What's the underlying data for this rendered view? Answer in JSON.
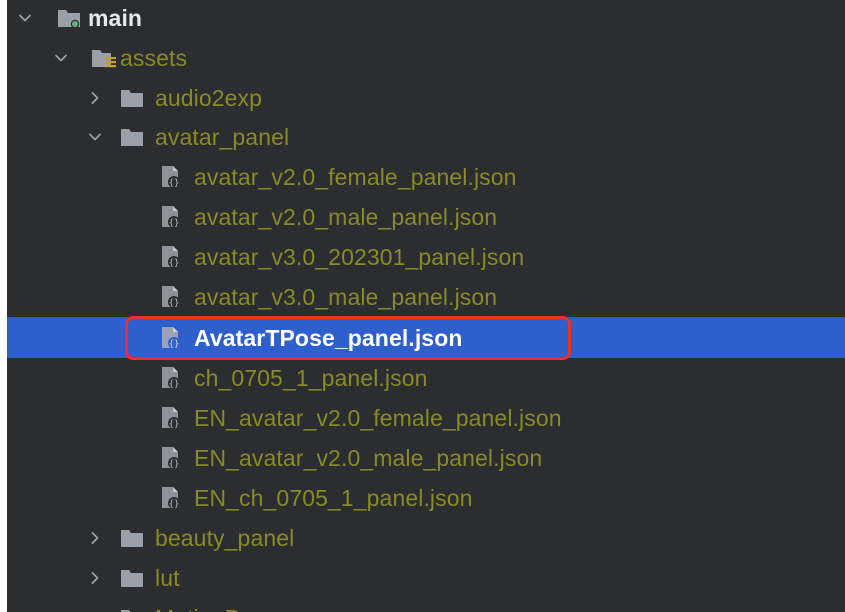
{
  "tree": {
    "root": {
      "label": "main",
      "icon": "module-folder-icon",
      "expanded": true
    },
    "assets": {
      "label": "assets",
      "icon": "resource-folder-icon",
      "expanded": true
    },
    "audio2exp": {
      "label": "audio2exp",
      "icon": "folder-icon",
      "expanded": false
    },
    "avatar_panel": {
      "label": "avatar_panel",
      "icon": "folder-icon",
      "expanded": true,
      "files": [
        {
          "label": "avatar_v2.0_female_panel.json",
          "icon": "json-file-icon"
        },
        {
          "label": "avatar_v2.0_male_panel.json",
          "icon": "json-file-icon"
        },
        {
          "label": "avatar_v3.0_202301_panel.json",
          "icon": "json-file-icon"
        },
        {
          "label": "avatar_v3.0_male_panel.json",
          "icon": "json-file-icon"
        },
        {
          "label": "AvatarTPose_panel.json",
          "icon": "json-file-icon",
          "selected": true
        },
        {
          "label": "ch_0705_1_panel.json",
          "icon": "json-file-icon"
        },
        {
          "label": "EN_avatar_v2.0_female_panel.json",
          "icon": "json-file-icon"
        },
        {
          "label": "EN_avatar_v2.0_male_panel.json",
          "icon": "json-file-icon"
        },
        {
          "label": "EN_ch_0705_1_panel.json",
          "icon": "json-file-icon"
        }
      ]
    },
    "beauty_panel": {
      "label": "beauty_panel",
      "icon": "folder-icon",
      "expanded": false
    },
    "lut": {
      "label": "lut",
      "icon": "folder-icon",
      "expanded": false
    },
    "partial": {
      "label": "MotionP",
      "icon": "folder-icon",
      "expanded": false
    }
  },
  "colors": {
    "background": "#2b2d30",
    "selection": "#2f5fcc",
    "highlight_border": "#e5322d",
    "file_text": "#8a8a27"
  }
}
